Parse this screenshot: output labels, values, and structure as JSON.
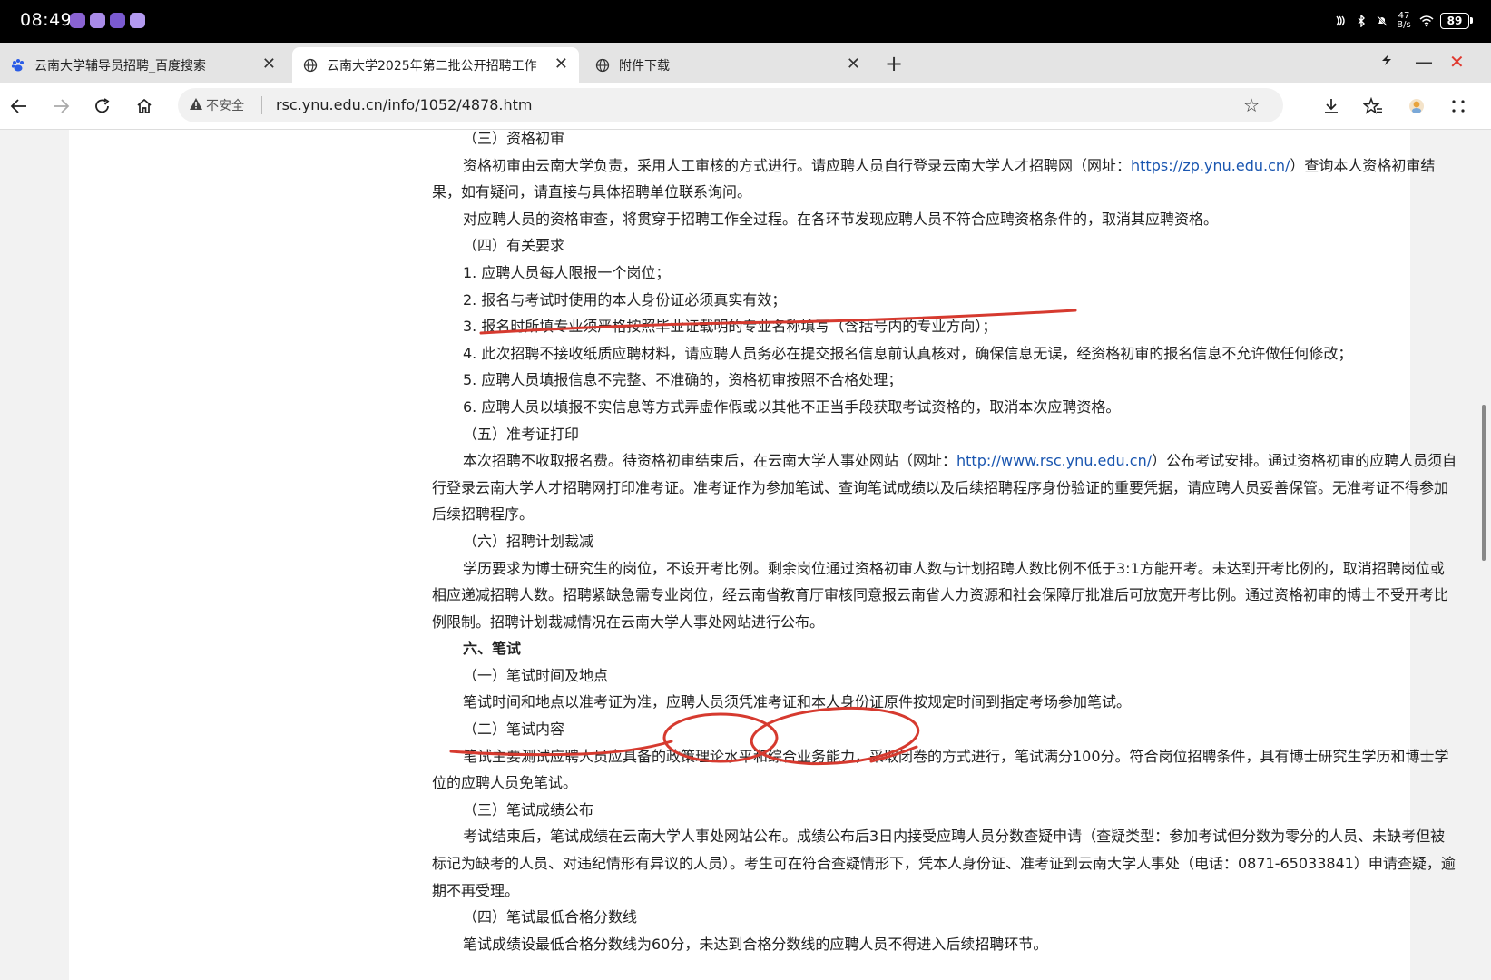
{
  "status": {
    "time": "08:49",
    "net_speed_top": "47",
    "net_speed_bottom": "B/s",
    "battery": "89"
  },
  "tabs": [
    {
      "title": "云南大学辅导员招聘_百度搜索",
      "favicon": "baidu-paw-icon"
    },
    {
      "title": "云南大学2025年第二批公开招聘工作",
      "favicon": "globe-icon"
    },
    {
      "title": "附件下载",
      "favicon": "globe-icon"
    }
  ],
  "omnibox": {
    "security_label": "不安全",
    "url": "rsc.ynu.edu.cn/info/1052/4878.htm"
  },
  "article": {
    "s3_heading": "（三）资格初审",
    "s3_p1a": "资格初审由云南大学负责，采用人工审核的方式进行。请应聘人员自行登录云南大学人才招聘网（网址：",
    "s3_p1_link": "https://zp.ynu.edu.cn/",
    "s3_p1b": "）查询本人资格初审结果，如有疑问，请直接与具体招聘单位联系询问。",
    "s3_p2": "对应聘人员的资格审查，将贯穿于招聘工作全过程。在各环节发现应聘人员不符合应聘资格条件的，取消其应聘资格。",
    "s4_heading": "（四）有关要求",
    "s4_i1": "1. 应聘人员每人限报一个岗位；",
    "s4_i2": "2. 报名与考试时使用的本人身份证必须真实有效；",
    "s4_i3": "3. 报名时所填专业须严格按照毕业证载明的专业名称填写（含括号内的专业方向）；",
    "s4_i4": "4. 此次招聘不接收纸质应聘材料，请应聘人员务必在提交报名信息前认真核对，确保信息无误，经资格初审的报名信息不允许做任何修改；",
    "s4_i5": "5. 应聘人员填报信息不完整、不准确的，资格初审按照不合格处理；",
    "s4_i6": "6. 应聘人员以填报不实信息等方式弄虚作假或以其他不正当手段获取考试资格的，取消本次应聘资格。",
    "s5_heading": "（五）准考证打印",
    "s5_pa": "本次招聘不收取报名费。待资格初审结束后，在云南大学人事处网站（网址：",
    "s5_link": "http://www.rsc.ynu.edu.cn/",
    "s5_pb": "）公布考试安排。通过资格初审的应聘人员须自行登录云南大学人才招聘网打印准考证。准考证作为参加笔试、查询笔试成绩以及后续招聘程序身份验证的重要凭据，请应聘人员妥善保管。无准考证不得参加后续招聘程序。",
    "s6_heading": "（六）招聘计划裁减",
    "s6_p": "学历要求为博士研究生的岗位，不设开考比例。剩余岗位通过资格初审人数与计划招聘人数比例不低于3:1方能开考。未达到开考比例的，取消招聘岗位或相应递减招聘人数。招聘紧缺急需专业岗位，经云南省教育厅审核同意报云南省人力资源和社会保障厅批准后可放宽开考比例。通过资格初审的博士不受开考比例限制。招聘计划裁减情况在云南大学人事处网站进行公布。",
    "sec6_title": "六、笔试",
    "w1_heading": "（一）笔试时间及地点",
    "w1_p": "笔试时间和地点以准考证为准，应聘人员须凭准考证和本人身份证原件按规定时间到指定考场参加笔试。",
    "w2_heading": "（二）笔试内容",
    "w2_p": "笔试主要测试应聘人员应具备的政策理论水平和综合业务能力，采取闭卷的方式进行，笔试满分100分。符合岗位招聘条件，具有博士研究生学历和博士学位的应聘人员免笔试。",
    "w3_heading": "（三）笔试成绩公布",
    "w3_p": "考试结束后，笔试成绩在云南大学人事处网站公布。成绩公布后3日内接受应聘人员分数查疑申请（查疑类型：参加考试但分数为零分的人员、未缺考但被标记为缺考的人员、对违纪情形有异议的人员）。考生可在符合查疑情形下，凭本人身份证、准考证到云南大学人事处（电话：0871-65033841）申请查疑，逾期不再受理。",
    "w4_heading": "（四）笔试最低合格分数线",
    "w4_p": "笔试成绩设最低合格分数线为60分，未达到合格分数线的应聘人员不得进入后续招聘环节。"
  },
  "colors": {
    "ink": "#d63a2f",
    "link": "#1a56b0",
    "close_red": "#e0392f"
  }
}
